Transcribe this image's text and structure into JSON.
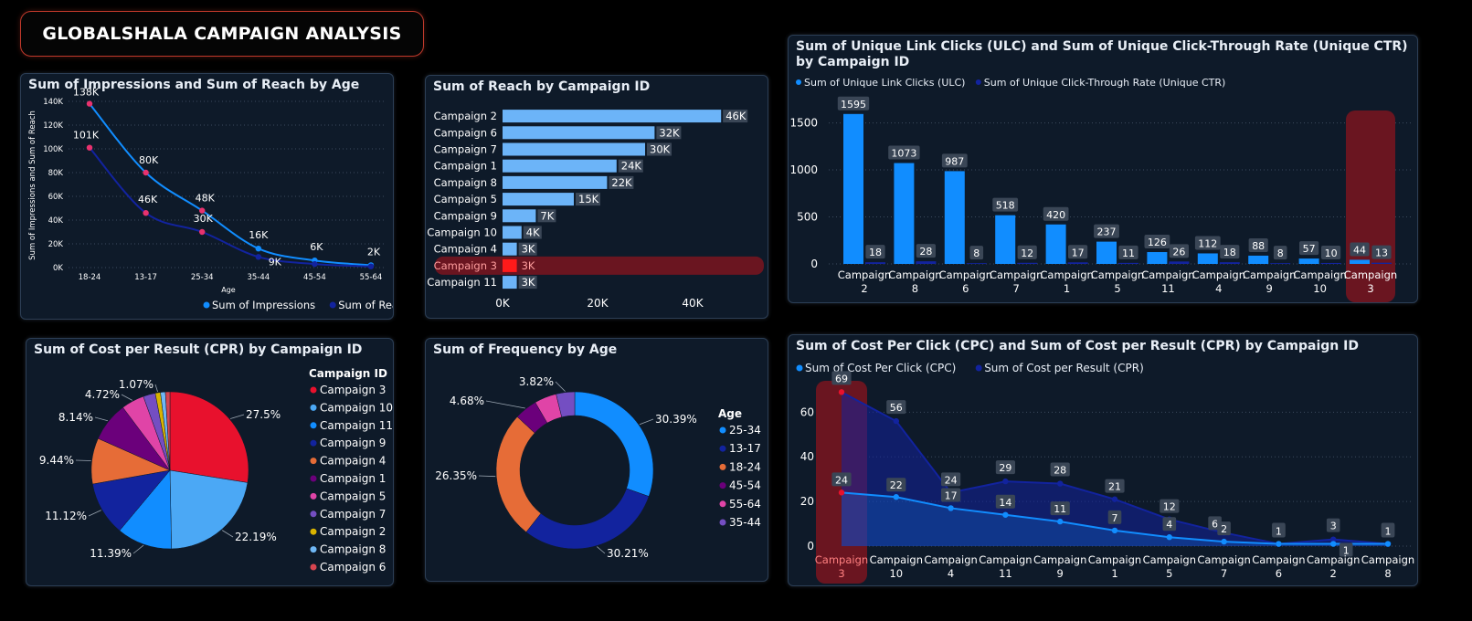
{
  "page_title": "GLOBALSHALA CAMPAIGN ANALYSIS",
  "colors": {
    "background": "#000000",
    "card": "#0e1a29",
    "accent_red": "#e8112d",
    "bright_blue": "#118dff",
    "dark_blue": "#12239e",
    "light_blue": "#6cb4f8"
  },
  "chart_data": [
    {
      "type": "line",
      "title": "Sum of Impressions and Sum of Reach by Age",
      "xlabel": "Age",
      "ylabel": "Sum of Impressions and Sum of Reach",
      "categories": [
        "18-24",
        "13-17",
        "25-34",
        "35-44",
        "45-54",
        "55-64"
      ],
      "yticks": [
        "0K",
        "20K",
        "40K",
        "60K",
        "80K",
        "100K",
        "120K",
        "140K"
      ],
      "ylim": [
        0,
        140000
      ],
      "series": [
        {
          "name": "Sum of Impressions",
          "color": "#118dff",
          "values": [
            138000,
            80000,
            48000,
            16000,
            6000,
            2000
          ],
          "labels": [
            "138K",
            "80K",
            "48K",
            "16K",
            "6K",
            "2K"
          ]
        },
        {
          "name": "Sum of Reach",
          "color": "#12239e",
          "values": [
            101000,
            46000,
            30000,
            9000,
            3000,
            1000
          ],
          "labels": [
            "101K",
            "46K",
            "30K",
            "9K",
            "",
            ""
          ]
        }
      ],
      "legend": "bottom-right"
    },
    {
      "type": "bar",
      "orientation": "horizontal",
      "title": "Sum of Reach by Campaign ID",
      "categories": [
        "Campaign 2",
        "Campaign 6",
        "Campaign 7",
        "Campaign 1",
        "Campaign 8",
        "Campaign 5",
        "Campaign 9",
        "Campaign 10",
        "Campaign 4",
        "Campaign 3",
        "Campaign 11"
      ],
      "values": [
        46000,
        32000,
        30000,
        24000,
        22000,
        15000,
        7000,
        4000,
        3000,
        3000,
        3000
      ],
      "labels": [
        "46K",
        "32K",
        "30K",
        "24K",
        "22K",
        "15K",
        "7K",
        "4K",
        "3K",
        "3K",
        "3K"
      ],
      "highlight": "Campaign 3",
      "xticks": [
        "0K",
        "20K",
        "40K"
      ],
      "xlim": [
        0,
        50000
      ]
    },
    {
      "type": "bar",
      "title": "Sum of Unique Link Clicks (ULC) and Sum of Unique Click-Through Rate (Unique CTR) by Campaign ID",
      "categories": [
        "Campaign 2",
        "Campaign 8",
        "Campaign 6",
        "Campaign 7",
        "Campaign 1",
        "Campaign 5",
        "Campaign 11",
        "Campaign 4",
        "Campaign 9",
        "Campaign 10",
        "Campaign 3"
      ],
      "series": [
        {
          "name": "Sum of Unique Link Clicks (ULC)",
          "color": "#118dff",
          "values": [
            1595,
            1073,
            987,
            518,
            420,
            237,
            126,
            112,
            88,
            57,
            44
          ]
        },
        {
          "name": "Sum of Unique Click-Through Rate (Unique CTR)",
          "color": "#12239e",
          "values": [
            18,
            28,
            8,
            12,
            17,
            11,
            26,
            18,
            8,
            10,
            13
          ]
        }
      ],
      "yticks": [
        "0",
        "500",
        "1000",
        "1500"
      ],
      "ylim": [
        0,
        1700
      ],
      "highlight": "Campaign 3",
      "legend": "top-left"
    },
    {
      "type": "pie",
      "title": "Sum of Cost per Result (CPR) by Campaign ID",
      "legend_title": "Campaign ID",
      "slices": [
        {
          "name": "Campaign 3",
          "value": 27.5,
          "label": "27.5%",
          "color": "#e8112d"
        },
        {
          "name": "Campaign 10",
          "value": 22.19,
          "label": "22.19%",
          "color": "#4ba8f5"
        },
        {
          "name": "Campaign 11",
          "value": 11.39,
          "label": "11.39%",
          "color": "#118dff"
        },
        {
          "name": "Campaign 9",
          "value": 11.12,
          "label": "11.12%",
          "color": "#12239e"
        },
        {
          "name": "Campaign 4",
          "value": 9.44,
          "label": "9.44%",
          "color": "#e66c37"
        },
        {
          "name": "Campaign 1",
          "value": 8.14,
          "label": "8.14%",
          "color": "#6b007b"
        },
        {
          "name": "Campaign 5",
          "value": 4.72,
          "label": "4.72%",
          "color": "#e044a7"
        },
        {
          "name": "Campaign 7",
          "value": 2.5,
          "label": "",
          "color": "#744ec2"
        },
        {
          "name": "Campaign 2",
          "value": 1.07,
          "label": "1.07%",
          "color": "#d9b300"
        },
        {
          "name": "Campaign 8",
          "value": 1.0,
          "label": "",
          "color": "#6fb7f5"
        },
        {
          "name": "Campaign 6",
          "value": 0.93,
          "label": "",
          "color": "#d64550"
        }
      ],
      "legend": "right"
    },
    {
      "type": "pie",
      "subtype": "donut",
      "title": "Sum of Frequency by Age",
      "legend_title": "Age",
      "slices": [
        {
          "name": "25-34",
          "value": 30.39,
          "label": "30.39%",
          "color": "#118dff"
        },
        {
          "name": "13-17",
          "value": 30.21,
          "label": "30.21%",
          "color": "#12239e"
        },
        {
          "name": "18-24",
          "value": 26.35,
          "label": "26.35%",
          "color": "#e66c37"
        },
        {
          "name": "45-54",
          "value": 4.68,
          "label": "4.68%",
          "color": "#6b007b"
        },
        {
          "name": "55-64",
          "value": 4.55,
          "label": "",
          "color": "#e044a7"
        },
        {
          "name": "35-44",
          "value": 3.82,
          "label": "3.82%",
          "color": "#744ec2"
        }
      ],
      "legend": "right"
    },
    {
      "type": "area",
      "title": "Sum of Cost Per Click (CPC) and Sum of Cost per Result (CPR) by Campaign ID",
      "categories": [
        "Campaign 3",
        "Campaign 10",
        "Campaign 4",
        "Campaign 11",
        "Campaign 9",
        "Campaign 1",
        "Campaign 5",
        "Campaign 7",
        "Campaign 6",
        "Campaign 2",
        "Campaign 8"
      ],
      "series": [
        {
          "name": "Sum of Cost Per Click (CPC)",
          "color": "#118dff",
          "values": [
            24,
            22,
            17,
            14,
            11,
            7,
            4,
            2,
            1,
            1,
            1
          ]
        },
        {
          "name": "Sum of Cost per Result (CPR)",
          "color": "#12239e",
          "values": [
            69,
            56,
            24,
            29,
            28,
            21,
            12,
            6,
            1,
            3,
            1
          ]
        }
      ],
      "yticks": [
        "0",
        "20",
        "40",
        "60"
      ],
      "ylim": [
        0,
        72
      ],
      "highlight": "Campaign 3",
      "legend": "top-left"
    }
  ]
}
